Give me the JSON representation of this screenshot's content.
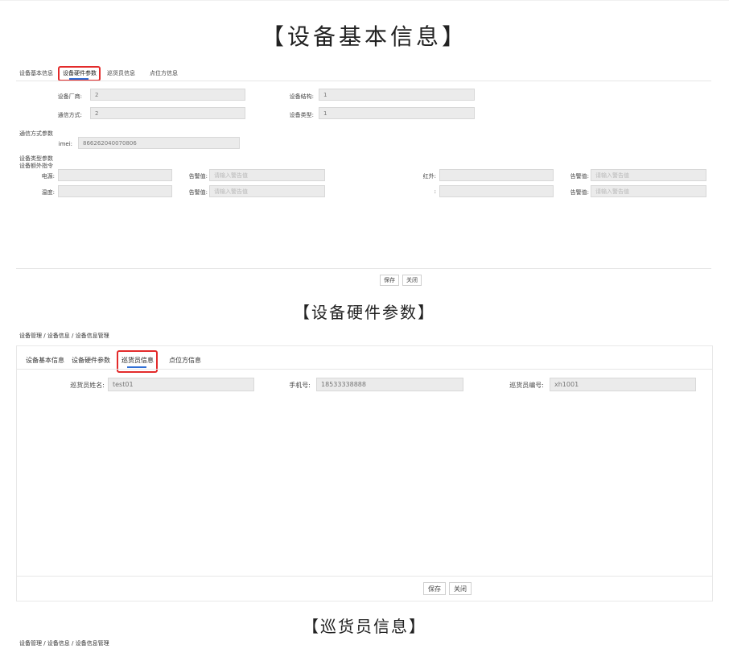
{
  "section1": {
    "title": "【设备基本信息】",
    "tabs": [
      "设备基本信息",
      "设备硬件参数",
      "巡货员信息",
      "点位方信息"
    ],
    "fields": {
      "manufacturer_label": "设备厂商:",
      "manufacturer_value": "2",
      "structure_label": "设备结构:",
      "structure_value": "1",
      "comm_label": "通信方式:",
      "comm_value": "2",
      "type_label": "设备类型:",
      "type_value": "1"
    },
    "comm_params_label": "通信方式参数",
    "imei_label": "imei:",
    "imei_value": "866262040070806",
    "type_params_label": "设备类型参数",
    "extra_cmd_label": "设备额外指令",
    "row1": {
      "label1": "电源:",
      "alarm1": "告警值:",
      "label2": "红外:",
      "alarm2": "告警值:"
    },
    "row2": {
      "label1": "温度:",
      "alarm1": "告警值:",
      "label2": ":",
      "alarm2": "告警值:"
    },
    "alarm_placeholder": "请输入警告值",
    "save": "保存",
    "close": "关闭"
  },
  "section2": {
    "title": "【设备硬件参数】",
    "breadcrumb": "设备管理 / 设备信息 / 设备信息管理",
    "tabs": [
      "设备基本信息",
      "设备硬件参数",
      "巡货员信息",
      "点位方信息"
    ],
    "name_label": "巡货员姓名:",
    "name_value": "test01",
    "phone_label": "手机号:",
    "phone_value": "18533338888",
    "code_label": "巡货员编号:",
    "code_value": "xh1001",
    "save": "保存",
    "close": "关闭"
  },
  "section3": {
    "title": "【巡货员信息】",
    "breadcrumb": "设备管理 / 设备信息 / 设备信息管理"
  },
  "colors": {
    "accent": "#2f6fd6",
    "highlight": "#e32b2b",
    "input_bg": "#ebebeb"
  }
}
